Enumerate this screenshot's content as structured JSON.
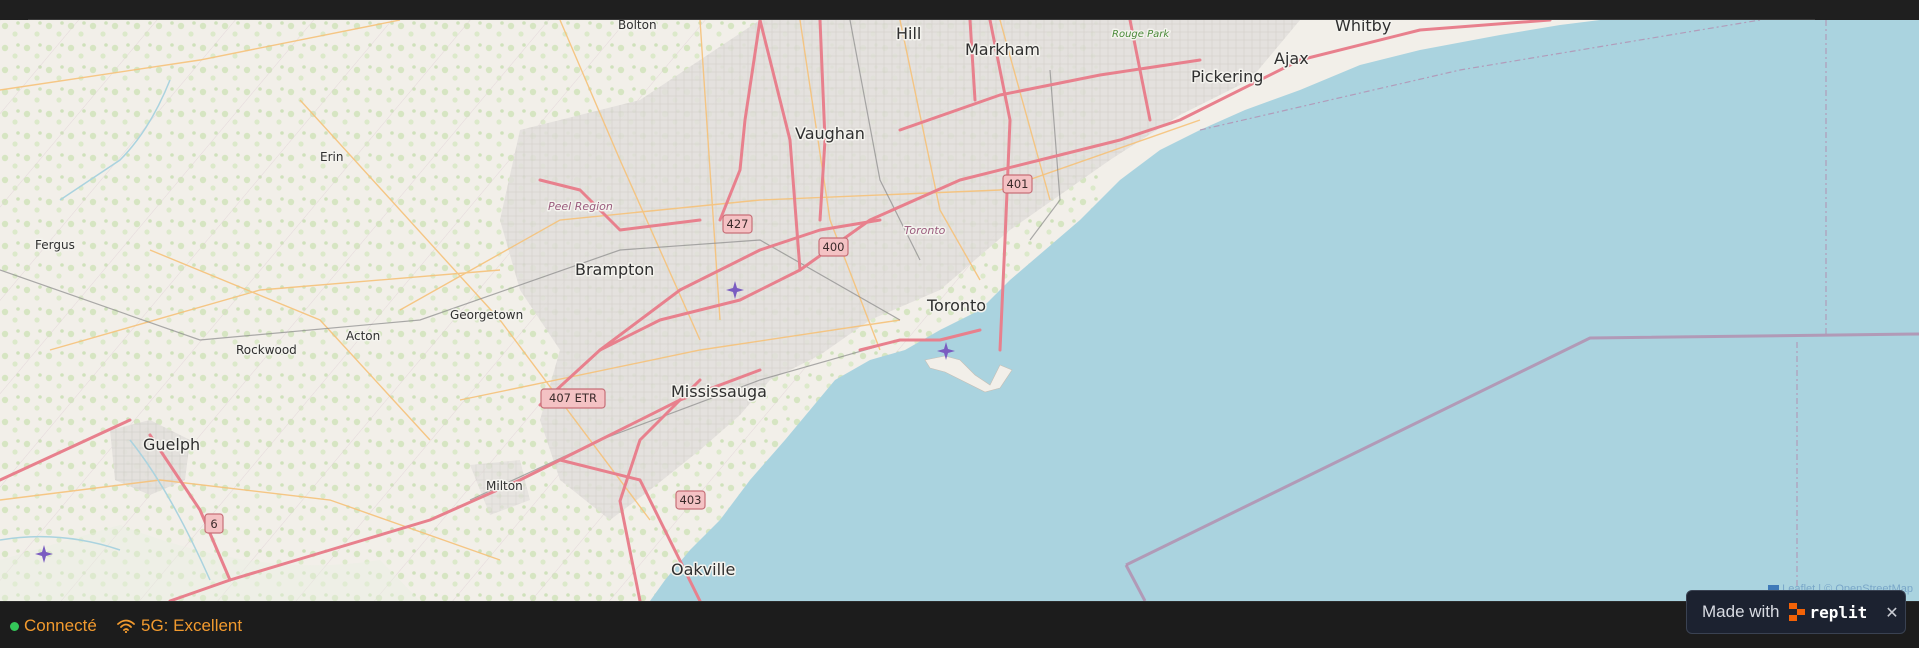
{
  "map": {
    "cities": [
      {
        "id": "bolton",
        "name": "Bolton"
      },
      {
        "id": "hill",
        "name": "Hill"
      },
      {
        "id": "markham",
        "name": "Markham"
      },
      {
        "id": "whitby",
        "name": "Whitby"
      },
      {
        "id": "ajax",
        "name": "Ajax"
      },
      {
        "id": "pickering",
        "name": "Pickering"
      },
      {
        "id": "vaughan",
        "name": "Vaughan"
      },
      {
        "id": "erin",
        "name": "Erin"
      },
      {
        "id": "fergus",
        "name": "Fergus"
      },
      {
        "id": "brampton",
        "name": "Brampton"
      },
      {
        "id": "georgetown",
        "name": "Georgetown"
      },
      {
        "id": "toronto",
        "name": "Toronto"
      },
      {
        "id": "acton",
        "name": "Acton"
      },
      {
        "id": "rockwood",
        "name": "Rockwood"
      },
      {
        "id": "mississauga",
        "name": "Mississauga"
      },
      {
        "id": "guelph",
        "name": "Guelph"
      },
      {
        "id": "milton",
        "name": "Milton"
      },
      {
        "id": "oakville",
        "name": "Oakville"
      }
    ],
    "regions": [
      {
        "id": "peel",
        "name": "Peel Region"
      },
      {
        "id": "toronto-region",
        "name": "Toronto"
      },
      {
        "id": "rouge",
        "name": "Rouge Park"
      }
    ],
    "shields": [
      {
        "id": "hwy-427",
        "label": "427"
      },
      {
        "id": "hwy-400",
        "label": "400"
      },
      {
        "id": "hwy-401",
        "label": "401"
      },
      {
        "id": "hwy-407",
        "label": "407 ETR"
      },
      {
        "id": "hwy-403",
        "label": "403"
      },
      {
        "id": "hwy-6",
        "label": "6"
      }
    ],
    "attribution": "Leaflet | © OpenStreetMap",
    "colors": {
      "water": "#aad3df",
      "land": "#f2efe9",
      "highway": "#e8808d",
      "arterial": "#f6c27a",
      "boundary": "#b38fb0",
      "wood": "#cfe3b8"
    }
  },
  "status": {
    "connection_label": "Connecté",
    "connection_color": "#34c759",
    "network_label": "5G: Excellent",
    "network_icon": "wifi-icon",
    "text_color": "#f29a2e"
  },
  "badge": {
    "made_with": "Made with",
    "brand": "replit",
    "close_symbol": "✕"
  }
}
